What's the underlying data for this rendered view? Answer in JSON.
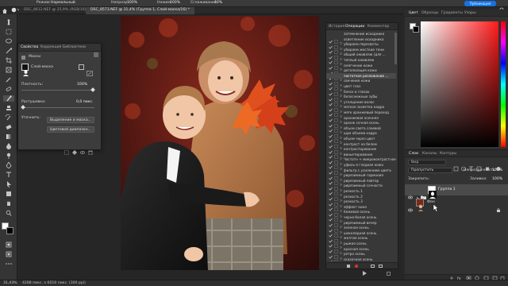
{
  "options_bar": {
    "mode_label": "Режим:",
    "mode_value": "Нормальный",
    "opacity_label": "Непрозр.:",
    "opacity_value": "100%",
    "pressure_label": "Нажим:",
    "pressure_value": "100%",
    "smoothing_label": "Сглаживание:",
    "smoothing_value": "10%",
    "publish_label": "Публикация"
  },
  "doc_tabs": [
    {
      "label": "DSC_8612.NEF @ 25,9% (RGB/16) ×"
    },
    {
      "label": "DSC_8573.NEF @ 31,4% (Группа 1, Слой-маска/16) *"
    }
  ],
  "properties_panel": {
    "tabs": [
      "Свойства",
      "Коррекция",
      "Библиотеки"
    ],
    "section_label": "Маски",
    "layer_label": "Слой-маска",
    "density_label": "Плотность:",
    "density_value": "100%",
    "feather_label": "Растушевка:",
    "feather_value": "0,0 пикс.",
    "refine_label": "Уточнить:",
    "select_mask_button": "Выделение и маска...",
    "color_range_button": "Цветовой диапазон..."
  },
  "operations_panel": {
    "tabs": [
      "История",
      "Операции",
      "Комментар"
    ],
    "items": [
      "затемнение исходника",
      "осветление исходника",
      "убираем пересветы",
      "убираем жесткие тени",
      "общий оживляж (для ...",
      "теплый оживляж",
      "смягчение кожи",
      "детализация кожи",
      "частотное разложение ...",
      "свечение кожи",
      "цвет глаз",
      "блеск в глазах",
      "белоснежные зубы",
      "утолщение волос",
      "мягкая засветка кадра",
      "мягк оранжевый переход",
      "оранжевая осенняя",
      "оранж сочная осень",
      "объем света слоевой",
      "шум объема кадра",
      "объем через цвет",
      "контраст на белом",
      "контрастирование",
      "виньетирование",
      "Частотн + микроконтрастное",
      "уфиль-я гладкая кожа",
      "фильтр с усилением цвета",
      "рирязимный гармония",
      "рирязимный повтор",
      "рирязимный сочности",
      "резкость 1",
      "резкость 2",
      "резкость 3",
      "эффект кино",
      "бежевая осень",
      "черно-белая осень",
      "рирязимный вечер",
      "зеленая осень",
      "шоколадная осень",
      "желтая осень",
      "рыжая осень",
      "красная осень",
      "ретро осень",
      "сказочная осень"
    ]
  },
  "color_panel": {
    "tabs": [
      "Цвет",
      "Образцы",
      "Градиенты",
      "Узоры"
    ],
    "base_hue": "#ff1a1a"
  },
  "layers_panel": {
    "tabs": [
      "Слои",
      "Каналы",
      "Контуры"
    ],
    "search_placeholder": "Вид",
    "blend_mode": "Пропустить",
    "opacity_label": "Непрозрачность:",
    "opacity_value": "100%",
    "lock_label": "Закрепить:",
    "fill_label": "Заливка:",
    "fill_value": "100%",
    "layers": [
      {
        "name": "Группа 1",
        "type": "group",
        "selected": true
      },
      {
        "name": "Фон",
        "type": "photo",
        "selected": false
      }
    ]
  },
  "status_bar": {
    "zoom": "31,43%",
    "doc_info": "4288 пикс. x 6016 пикс. (300 ppi)"
  }
}
